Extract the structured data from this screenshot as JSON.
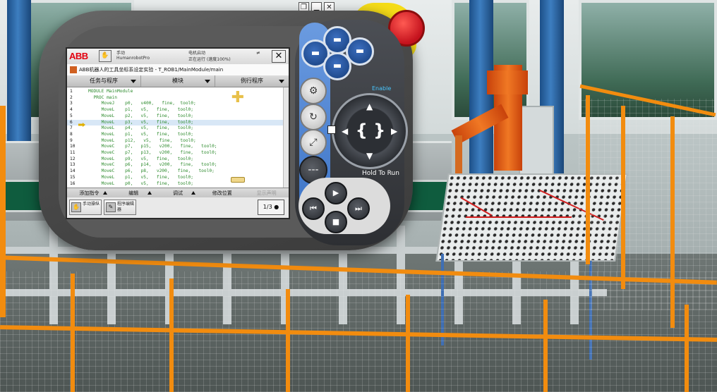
{
  "viewer": {
    "toolbar": [
      {
        "name": "restore-window-icon",
        "glyph": "❐"
      },
      {
        "name": "minimize-window-icon",
        "glyph": "▁"
      },
      {
        "name": "close-window-icon",
        "glyph": "✕"
      }
    ],
    "sub_icons": [
      "swap-icon",
      "camera-icon"
    ]
  },
  "pendant": {
    "brand": "ABB",
    "status": {
      "mode": "手动",
      "system": "HumanrobotPro",
      "motor": "电机启动",
      "state": "正在运行 (速度100%)",
      "flag": "≠"
    },
    "title": "ABB机器人的工具坐标系设定实验 - T_ROB1/MainModule/main",
    "menu": [
      "任务与程序",
      "模块",
      "例行程序"
    ],
    "code": [
      {
        "n": "1",
        "text": "MODULE MainModule"
      },
      {
        "n": "2",
        "text": "  PROC main"
      },
      {
        "n": "3",
        "text": "     MoveJ    p0,   v400,   fine,  tool0;"
      },
      {
        "n": "4",
        "text": "     MoveL    p1,   v5,   fine,   tool0;"
      },
      {
        "n": "5",
        "text": "     MoveL    p2,   v5,   fine,   tool0;"
      },
      {
        "n": "6",
        "text": "     MoveL    p3,   v5,   fine,   tool0;"
      },
      {
        "n": "7",
        "text": "     MoveL    p4,   v5,   fine,   tool0;"
      },
      {
        "n": "8",
        "text": "     MoveL    p1,   v5,   fine,   tool0;"
      },
      {
        "n": "9",
        "text": "     MoveL    p12,   v5,   fine,   tool0;"
      },
      {
        "n": "10",
        "text": "     MoveC    p7,   p15,   v200,   fine,   tool0;"
      },
      {
        "n": "11",
        "text": "     MoveC    p7,   p13,   v200,   fine,   tool0;"
      },
      {
        "n": "12",
        "text": "     MoveL    p9,   v5,   fine,   tool0;"
      },
      {
        "n": "13",
        "text": "     MoveC    p6,   p14,   v200,   fine,   tool0;"
      },
      {
        "n": "14",
        "text": "     MoveC    p6,   p8,   v200,   fine,   tool0;"
      },
      {
        "n": "15",
        "text": "     MoveL    p1,   v5,   fine,   tool0;"
      },
      {
        "n": "16",
        "text": "     MoveL    p0,   v5,   fine,   tool0;"
      }
    ],
    "current_line": 6,
    "bottom_menu": [
      {
        "label": "添加指令",
        "enabled": true
      },
      {
        "label": "编辑",
        "enabled": true
      },
      {
        "label": "调试",
        "enabled": true
      },
      {
        "label": "修改位置",
        "enabled": true
      },
      {
        "label": "显示声明",
        "enabled": false
      }
    ],
    "taskbar": [
      {
        "label": "手动操纵",
        "icon": "✋"
      },
      {
        "label": "程序编辑器",
        "icon": "✎"
      }
    ],
    "speed_label": "1/3",
    "hardware": {
      "enable_label": "Enable",
      "hold_label": "Hold To Run"
    }
  }
}
